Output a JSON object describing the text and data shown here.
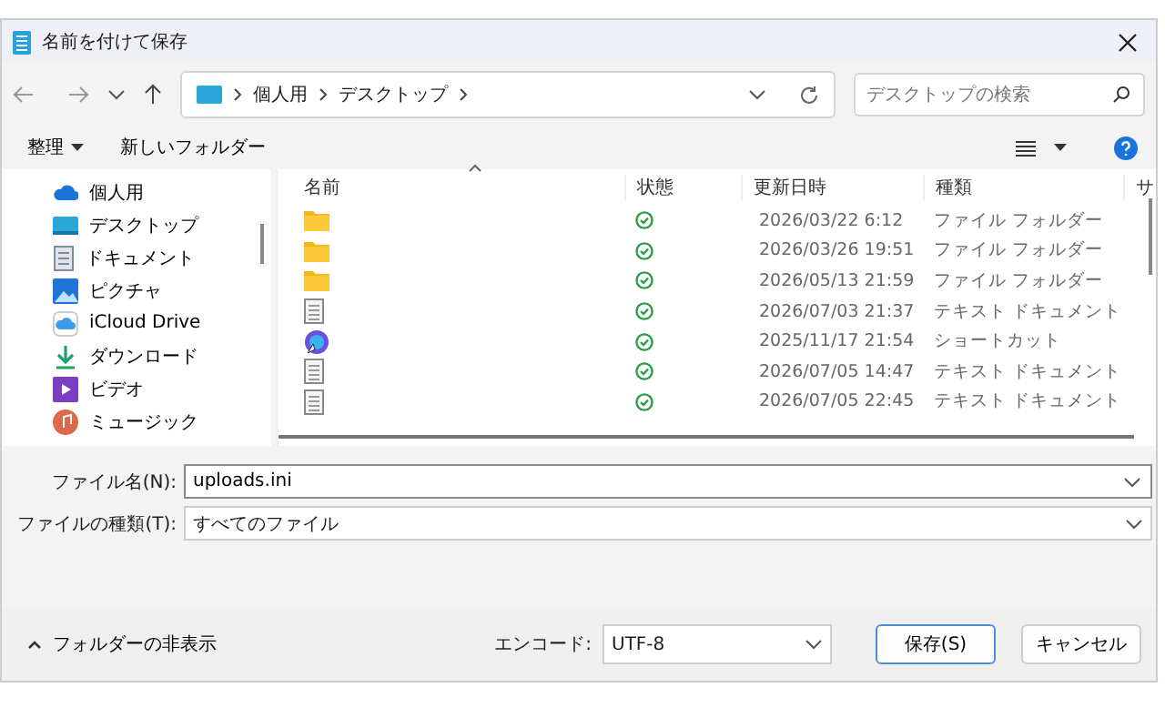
{
  "window": {
    "title": "名前を付けて保存"
  },
  "address": {
    "segments": [
      "個人用",
      "デスクトップ"
    ]
  },
  "search": {
    "placeholder": "デスクトップの検索"
  },
  "toolbar": {
    "organize": "整理",
    "new_folder": "新しいフォルダー"
  },
  "sidebar": {
    "items": [
      {
        "kind": "onedrive",
        "label": "個人用"
      },
      {
        "kind": "desktop",
        "label": "デスクトップ"
      },
      {
        "kind": "documents",
        "label": "ドキュメント"
      },
      {
        "kind": "pictures",
        "label": "ピクチャ"
      },
      {
        "kind": "icloud",
        "label": "iCloud Drive"
      },
      {
        "kind": "downloads",
        "label": "ダウンロード"
      },
      {
        "kind": "videos",
        "label": "ビデオ"
      },
      {
        "kind": "music",
        "label": "ミュージック"
      }
    ]
  },
  "table": {
    "columns": [
      "名前",
      "状態",
      "更新日時",
      "種類",
      "サ"
    ],
    "rows": [
      {
        "kind": "folder",
        "modified": "2026/03/22 6:12",
        "type": "ファイル フォルダー"
      },
      {
        "kind": "folder",
        "modified": "2026/03/26 19:51",
        "type": "ファイル フォルダー"
      },
      {
        "kind": "folder",
        "modified": "2026/05/13 21:59",
        "type": "ファイル フォルダー"
      },
      {
        "kind": "text",
        "modified": "2026/07/03 21:37",
        "type": "テキスト ドキュメント"
      },
      {
        "kind": "shortcut",
        "modified": "2025/11/17 21:54",
        "type": "ショートカット"
      },
      {
        "kind": "text",
        "modified": "2026/07/05 14:47",
        "type": "テキスト ドキュメント"
      },
      {
        "kind": "text",
        "modified": "2026/07/05 22:45",
        "type": "テキスト ドキュメント"
      }
    ]
  },
  "file_name": {
    "label": "ファイル名(N):",
    "value": "uploads.ini"
  },
  "file_type": {
    "label": "ファイルの種類(T):",
    "value": "すべてのファイル"
  },
  "footer": {
    "hide_folders": "フォルダーの非表示",
    "encoding_label": "エンコード:",
    "encoding": "UTF-8",
    "save": "保存(S)",
    "cancel": "キャンセル"
  }
}
